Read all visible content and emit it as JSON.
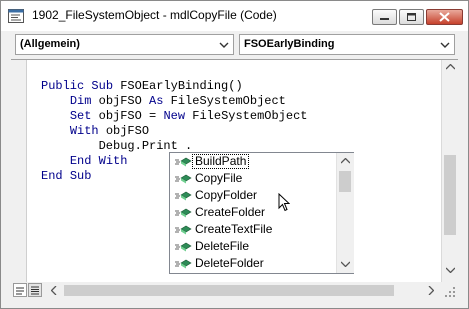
{
  "window": {
    "title": "1902_FileSystemObject - mdlCopyFile (Code)"
  },
  "combos": {
    "object": "(Allgemein)",
    "procedure": "FSOEarlyBinding"
  },
  "code": {
    "lines": [
      "Public Sub FSOEarlyBinding()",
      "    Dim objFSO As FileSystemObject",
      "    Set objFSO = New FileSystemObject",
      "    With objFSO",
      "        Debug.Print .",
      "    End With",
      "End Sub"
    ]
  },
  "intellisense": {
    "items": [
      {
        "label": "BuildPath",
        "icon": "method-icon",
        "selected": true
      },
      {
        "label": "CopyFile",
        "icon": "method-icon",
        "selected": false
      },
      {
        "label": "CopyFolder",
        "icon": "method-icon",
        "selected": false
      },
      {
        "label": "CreateFolder",
        "icon": "method-icon",
        "selected": false
      },
      {
        "label": "CreateTextFile",
        "icon": "method-icon",
        "selected": false
      },
      {
        "label": "DeleteFile",
        "icon": "method-icon",
        "selected": false
      },
      {
        "label": "DeleteFolder",
        "icon": "method-icon",
        "selected": false
      }
    ]
  },
  "colors": {
    "keyword": "#00008b",
    "close_button": "#c6412c",
    "method_icon": "#2e8b57"
  }
}
